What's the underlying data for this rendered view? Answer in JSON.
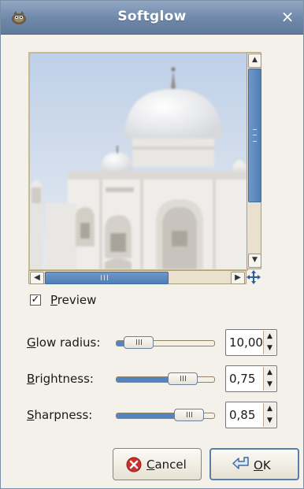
{
  "window": {
    "title": "Softglow"
  },
  "preview": {
    "label": "Preview",
    "label_first": "P",
    "label_rest": "review",
    "checked": true
  },
  "params": [
    {
      "label": "Glow radius:",
      "mnemonic": "G",
      "rest": "low radius:",
      "value": "10,00",
      "level": 0.1
    },
    {
      "label": "Brightness:",
      "mnemonic": "B",
      "rest": "rightness:",
      "value": "0,75",
      "level": 0.75
    },
    {
      "label": "Sharpness:",
      "mnemonic": "S",
      "rest": "harpness:",
      "value": "0,85",
      "level": 0.85
    }
  ],
  "buttons": {
    "cancel": {
      "label": "Cancel",
      "mnemonic": "C",
      "rest": "ancel"
    },
    "ok": {
      "label": "OK",
      "mnemonic": "O",
      "rest": "K"
    }
  },
  "colors": {
    "titlebar": "#6f88a9",
    "accent": "#5483c0",
    "window_bg": "#f4f1ea"
  },
  "icons": [
    "app-icon",
    "close-icon",
    "scroll-up-icon",
    "scroll-down-icon",
    "scroll-left-icon",
    "scroll-right-icon",
    "navigate-icon",
    "cancel-icon",
    "ok-icon"
  ]
}
